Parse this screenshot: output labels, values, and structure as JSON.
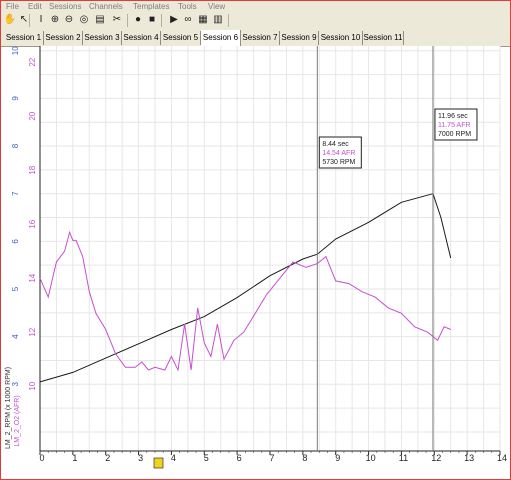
{
  "menu": [
    "File",
    "Edit",
    "Sessions",
    "Channels",
    "Templates",
    "Tools",
    "View"
  ],
  "toolbar_icons": [
    {
      "name": "hand-icon",
      "glyph": "✋"
    },
    {
      "name": "pointer-icon",
      "glyph": "↖"
    },
    {
      "name": "cursor-icon",
      "glyph": "I"
    },
    {
      "name": "zoom-in-icon",
      "glyph": "⊕"
    },
    {
      "name": "zoom-out-icon",
      "glyph": "⊖"
    },
    {
      "name": "zoom-reset-icon",
      "glyph": "◎"
    },
    {
      "name": "note-icon",
      "glyph": "▤"
    },
    {
      "name": "scissors-icon",
      "glyph": "✂"
    },
    {
      "name": "record-icon",
      "glyph": "●"
    },
    {
      "name": "stop-icon",
      "glyph": "■"
    },
    {
      "name": "play-icon",
      "glyph": "▶"
    },
    {
      "name": "binoculars-icon",
      "glyph": "∞"
    },
    {
      "name": "report-icon",
      "glyph": "▦"
    },
    {
      "name": "grid-icon",
      "glyph": "▥"
    }
  ],
  "tabs": [
    "Session 1",
    "Session 2",
    "Session 3",
    "Session 4",
    "Session 5",
    "Session 6",
    "Session 7",
    "Session 9",
    "Session 10",
    "Session 11"
  ],
  "active_tab": "Session 6",
  "colors": {
    "rpm": "#1a1a1a",
    "afr": "#c64fcf",
    "grid": "#e6e6e6",
    "cursor": "#7a7a7a",
    "axis_blue": "#3f5fbf",
    "axis_magenta": "#c64fcf"
  },
  "chart_data": {
    "type": "line",
    "x_ticks": [
      "0",
      "1",
      "2",
      "3",
      "4",
      "5",
      "6",
      "7",
      "8",
      "9",
      "10",
      "11",
      "12",
      "13",
      "14"
    ],
    "xlim": [
      0,
      14
    ],
    "rpm_axis_label": "LM_2_RPM (x 1000 RPM)",
    "afr_axis_label": "LM_2_O2 (AFR)",
    "rpm_ticks": [
      "3",
      "4",
      "5",
      "6",
      "7",
      "8",
      "9",
      "10"
    ],
    "afr_ticks": [
      "10",
      "12",
      "14",
      "16",
      "18",
      "20",
      "22"
    ],
    "rpm_ylim": [
      1.6,
      10.1
    ],
    "afr_ylim": [
      7.6,
      22.6
    ],
    "series": [
      {
        "name": "LM_2_RPM",
        "key": "rpm",
        "x": [
          0,
          1,
          2,
          3,
          4,
          5,
          6,
          7,
          8,
          8.44,
          9,
          10,
          11,
          11.96,
          12.2,
          12.5
        ],
        "y": [
          3.05,
          3.25,
          3.55,
          3.85,
          4.15,
          4.42,
          4.82,
          5.28,
          5.63,
          5.73,
          6.05,
          6.4,
          6.82,
          7.0,
          6.5,
          5.65
        ]
      },
      {
        "name": "LM_2_O2",
        "key": "afr",
        "x": [
          0,
          0.25,
          0.5,
          0.75,
          0.9,
          1.0,
          1.1,
          1.3,
          1.5,
          1.7,
          2.0,
          2.3,
          2.6,
          2.9,
          3.1,
          3.3,
          3.5,
          3.8,
          4.0,
          4.2,
          4.4,
          4.6,
          4.8,
          5.0,
          5.2,
          5.4,
          5.6,
          5.9,
          6.2,
          6.5,
          6.9,
          7.3,
          7.7,
          8.1,
          8.44,
          8.7,
          9.0,
          9.4,
          9.8,
          10.2,
          10.6,
          11.0,
          11.4,
          11.8,
          12.1,
          12.3,
          12.5
        ],
        "y": [
          14.0,
          13.3,
          14.6,
          15.0,
          15.7,
          15.4,
          15.4,
          14.8,
          13.5,
          12.7,
          12.1,
          11.2,
          10.7,
          10.7,
          10.9,
          10.6,
          10.7,
          10.6,
          11.1,
          10.6,
          12.3,
          10.6,
          12.9,
          11.6,
          11.1,
          12.3,
          11.0,
          11.7,
          12.0,
          12.6,
          13.4,
          14.0,
          14.6,
          14.4,
          14.54,
          14.8,
          13.9,
          13.8,
          13.5,
          13.3,
          12.9,
          12.7,
          12.2,
          12.0,
          11.7,
          12.2,
          12.1
        ]
      }
    ],
    "cursors": [
      {
        "x": 8.44,
        "lines": [
          "8.44 sec",
          "14.54 AFR",
          "5730 RPM"
        ]
      },
      {
        "x": 11.96,
        "lines": [
          "11.96 sec",
          "11.75 AFR",
          "7000 RPM"
        ]
      }
    ],
    "grid": true
  }
}
